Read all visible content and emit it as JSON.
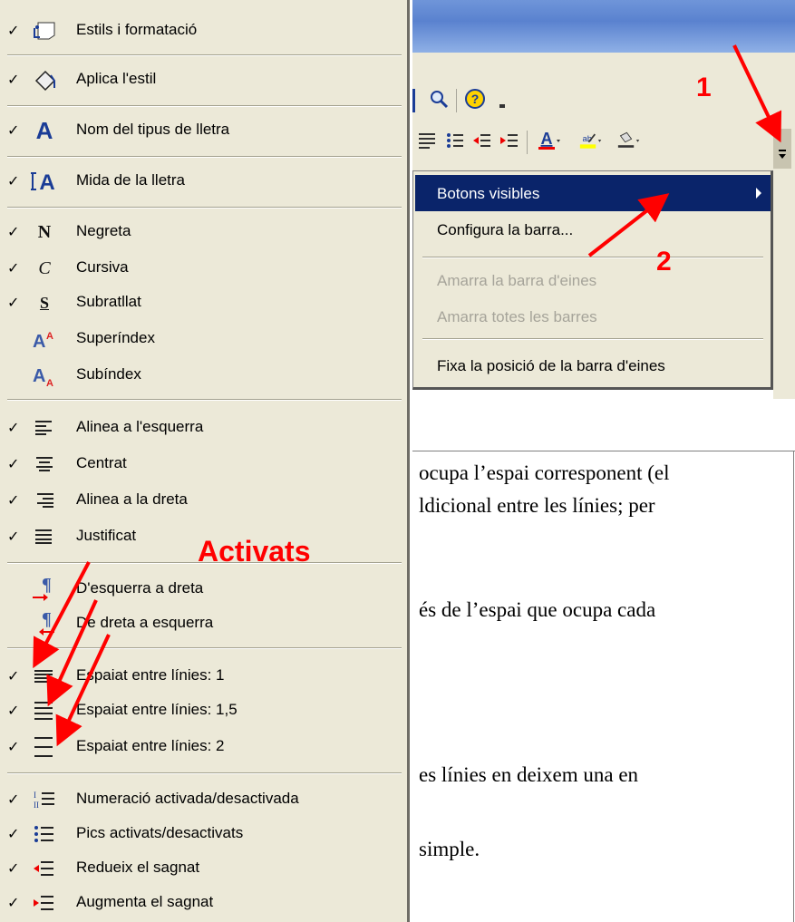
{
  "menu": {
    "items": [
      {
        "label": "Estils i formatació",
        "checked": true,
        "icon": "styles-formatting-icon"
      },
      {
        "label": "Aplica l'estil",
        "checked": true,
        "icon": "apply-style-icon"
      },
      {
        "label": "Nom del tipus de lletra",
        "checked": true,
        "icon": "font-name-icon"
      },
      {
        "label": "Mida de la lletra",
        "checked": true,
        "icon": "font-size-icon"
      },
      {
        "label": "Negreta",
        "checked": true,
        "icon": "bold-icon"
      },
      {
        "label": "Cursiva",
        "checked": true,
        "icon": "italic-icon"
      },
      {
        "label": "Subratllat",
        "checked": true,
        "icon": "underline-icon"
      },
      {
        "label": "Superíndex",
        "checked": false,
        "icon": "superscript-icon"
      },
      {
        "label": "Subíndex",
        "checked": false,
        "icon": "subscript-icon"
      },
      {
        "label": "Alinea a l'esquerra",
        "checked": true,
        "icon": "align-left-icon"
      },
      {
        "label": "Centrat",
        "checked": true,
        "icon": "align-center-icon"
      },
      {
        "label": "Alinea a la dreta",
        "checked": true,
        "icon": "align-right-icon"
      },
      {
        "label": "Justificat",
        "checked": true,
        "icon": "justify-icon"
      },
      {
        "label": "D'esquerra a dreta",
        "checked": false,
        "icon": "ltr-icon"
      },
      {
        "label": "De dreta a esquerra",
        "checked": false,
        "icon": "rtl-icon"
      },
      {
        "label": "Espaiat entre línies: 1",
        "checked": true,
        "icon": "line-spacing-1-icon"
      },
      {
        "label": "Espaiat entre línies: 1,5",
        "checked": true,
        "icon": "line-spacing-1-5-icon"
      },
      {
        "label": "Espaiat entre línies: 2",
        "checked": true,
        "icon": "line-spacing-2-icon"
      },
      {
        "label": "Numeració activada/desactivada",
        "checked": true,
        "icon": "numbering-icon"
      },
      {
        "label": "Pics activats/desactivats",
        "checked": true,
        "icon": "bullets-icon"
      },
      {
        "label": "Redueix el sagnat",
        "checked": true,
        "icon": "decrease-indent-icon"
      },
      {
        "label": "Augmenta el sagnat",
        "checked": true,
        "icon": "increase-indent-icon"
      }
    ],
    "check_glyph": "✓"
  },
  "popup": {
    "items": [
      {
        "label": "Botons visibles",
        "state": "highlighted"
      },
      {
        "label": "Configura la barra...",
        "state": "normal"
      },
      {
        "label": "Amarra la barra d'eines",
        "state": "disabled"
      },
      {
        "label": "Amarra totes les barres",
        "state": "disabled"
      },
      {
        "label": "Fixa la posició de la barra d'eines",
        "state": "normal"
      }
    ]
  },
  "annotations": {
    "label_1": "1",
    "label_2": "2",
    "label_activats": "Activats",
    "color": "#ff0000"
  },
  "document": {
    "lines": [
      "ocupa l’espai corresponent (el",
      "ldicional entre les línies; per",
      "és de l’espai que ocupa cada",
      "es línies en deixem una en",
      "simple."
    ]
  },
  "colors": {
    "menu_bg": "#ece9d8",
    "highlight": "#0a246a",
    "disabled_text": "#a6a49a"
  }
}
